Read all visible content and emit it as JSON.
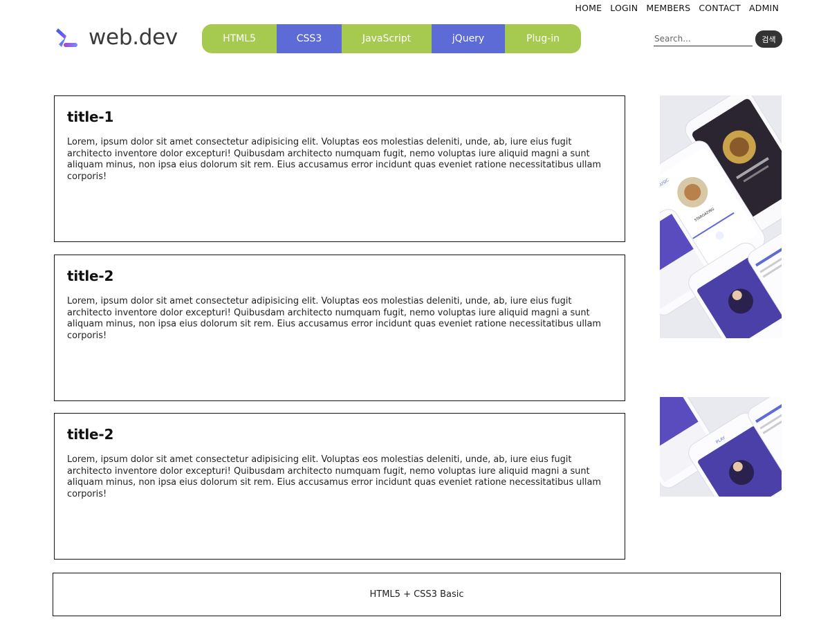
{
  "util_nav": [
    "HOME",
    "LOGIN",
    "MEMBERS",
    "CONTACT",
    "ADMIN"
  ],
  "logo": {
    "text": "web.dev"
  },
  "main_nav": [
    {
      "label": "HTML5",
      "color": "#a6c94f"
    },
    {
      "label": "CSS3",
      "color": "#5d6bd7"
    },
    {
      "label": "JavaScript",
      "color": "#a6c94f"
    },
    {
      "label": "jQuery",
      "color": "#5d6bd7"
    },
    {
      "label": "Plug-in",
      "color": "#a6c94f"
    }
  ],
  "search": {
    "placeholder": "Search...",
    "button_label": "검색"
  },
  "articles": [
    {
      "title": "title-1",
      "body": "Lorem, ipsum dolor sit amet consectetur adipisicing elit. Voluptas eos molestias deleniti, unde, ab, iure eius fugit architecto inventore dolor excepturi! Quibusdam architecto numquam fugit, nemo voluptas iure aliquid magni a sunt aliquam minus, non ipsa eius dolorum sit rem. Eius accusamus error incidunt quas eveniet ratione necessitatibus ullam corporis!"
    },
    {
      "title": "title-2",
      "body": "Lorem, ipsum dolor sit amet consectetur adipisicing elit. Voluptas eos molestias deleniti, unde, ab, iure eius fugit architecto inventore dolor excepturi! Quibusdam architecto numquam fugit, nemo voluptas iure aliquid magni a sunt aliquam minus, non ipsa eius dolorum sit rem. Eius accusamus error incidunt quas eveniet ratione necessitatibus ullam corporis!"
    },
    {
      "title": "title-2",
      "body": "Lorem, ipsum dolor sit amet consectetur adipisicing elit. Voluptas eos molestias deleniti, unde, ab, iure eius fugit architecto inventore dolor excepturi! Quibusdam architecto numquam fugit, nemo voluptas iure aliquid magni a sunt aliquam minus, non ipsa eius dolorum sit rem. Eius accusamus error incidunt quas eveniet ratione necessitatibus ullam corporis!"
    }
  ],
  "side_images": [
    {
      "label": "MUSIC",
      "sublabel": "STARGAZING"
    },
    {
      "label": "PLAY",
      "sublabel": ""
    }
  ],
  "footer": {
    "text": "HTML5 + CSS3 Basic"
  },
  "colors": {
    "green": "#a6c94f",
    "blue": "#5d6bd7",
    "purple": "#4b3fa8"
  }
}
